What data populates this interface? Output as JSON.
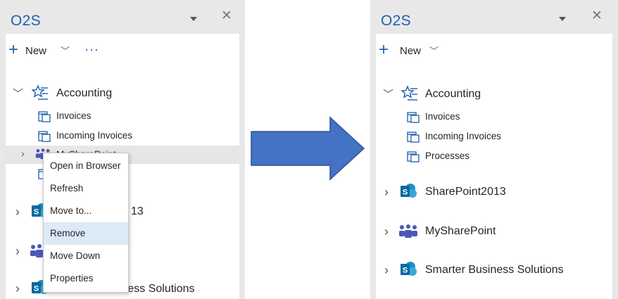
{
  "left_panel": {
    "title": "O2S",
    "toolbar": {
      "new_label": "New",
      "more_label": "···"
    },
    "tree": {
      "accounting": "Accounting",
      "invoices": "Invoices",
      "incoming_invoices": "Incoming Invoices",
      "mysharepoint": "MySharePoint",
      "sharepoint_partial": "13",
      "smarter_partial": "Smarter Business Solutions"
    },
    "context_menu": {
      "items": [
        "Open in Browser",
        "Refresh",
        "Move to...",
        "Remove",
        "Move Down",
        "Properties"
      ],
      "active_index": 3
    }
  },
  "right_panel": {
    "title": "O2S",
    "toolbar": {
      "new_label": "New"
    },
    "tree": {
      "accounting": "Accounting",
      "invoices": "Invoices",
      "incoming_invoices": "Incoming Invoices",
      "processes": "Processes",
      "sharepoint2013": "SharePoint2013",
      "mysharepoint": "MySharePoint",
      "smarter": "Smarter Business Solutions"
    }
  },
  "colors": {
    "accent": "#1f5fae",
    "arrow": "#4472c4",
    "panel_bg": "#e8e8e8",
    "menu_active": "#dceaf7",
    "sharepoint": "#0b6a9e",
    "teams": "#4b58b8"
  },
  "icons": {
    "close": "close-icon",
    "caret": "caret-down-icon",
    "favorites": "star-list-icon",
    "list": "list-icon",
    "sharepoint": "sharepoint-icon",
    "teams": "teams-icon"
  }
}
